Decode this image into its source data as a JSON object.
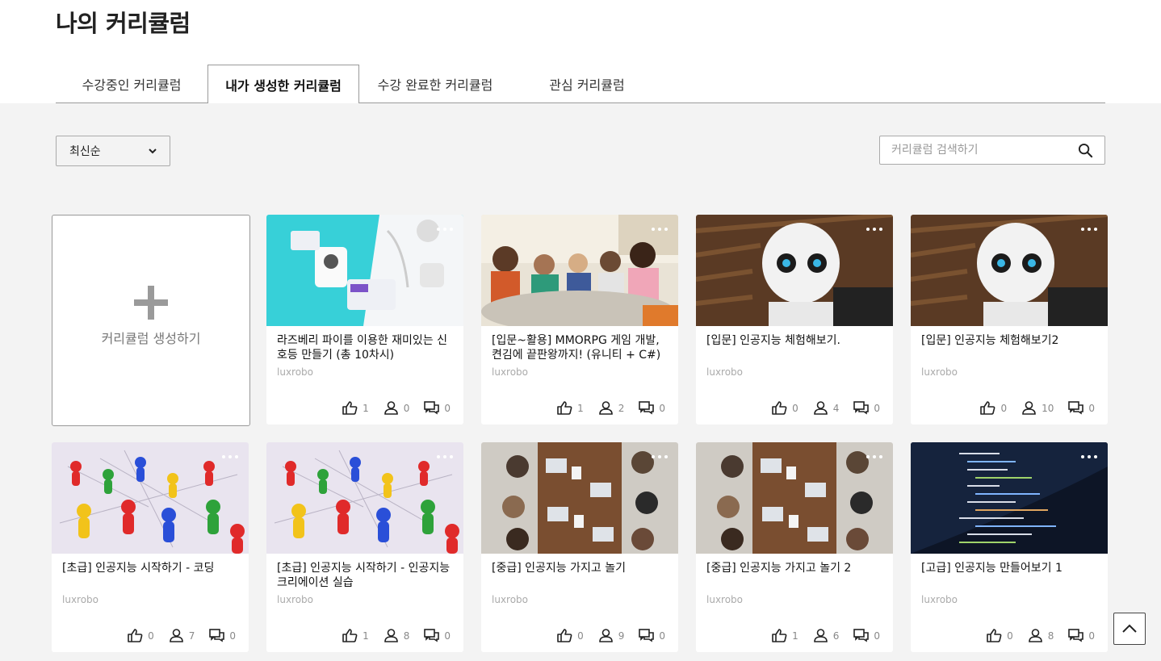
{
  "page": {
    "title": "나의 커리큘럼"
  },
  "tabs": [
    {
      "label": "수강중인 커리큘럼",
      "active": false
    },
    {
      "label": "내가 생성한 커리큘럼",
      "active": true
    },
    {
      "label": "수강 완료한 커리큘럼",
      "active": false
    },
    {
      "label": "관심 커리큘럼",
      "active": false
    }
  ],
  "sort": {
    "selected": "최신순",
    "icon": "chevron-down-icon"
  },
  "search": {
    "placeholder": "커리큘럼 검색하기",
    "value": "",
    "icon": "search-icon"
  },
  "create_card": {
    "label": "커리큘럼 생성하기",
    "icon": "plus-icon"
  },
  "cards": [
    {
      "title": "라즈베리 파이를 이용한 재미있는 신호등 만들기 (총 10차시)",
      "author": "luxrobo",
      "likes": "1",
      "students": "0",
      "comments": "0",
      "image": "robot-kit-modules"
    },
    {
      "title": "[입문~활용] MMORPG 게임 개발, 켠김에 끝판왕까지! (유니티 + C#)",
      "author": "luxrobo",
      "likes": "1",
      "students": "2",
      "comments": "0",
      "image": "students-at-table"
    },
    {
      "title": "[입문] 인공지능 체험해보기.",
      "author": "luxrobo",
      "likes": "0",
      "students": "4",
      "comments": "0",
      "image": "humanoid-robot"
    },
    {
      "title": "[입문] 인공지능 체험해보기2",
      "author": "luxrobo",
      "likes": "0",
      "students": "10",
      "comments": "0",
      "image": "humanoid-robot"
    },
    {
      "title": "[초급] 인공지능 시작하기 - 코딩",
      "author": "luxrobo",
      "likes": "0",
      "students": "7",
      "comments": "0",
      "image": "network-pawns"
    },
    {
      "title": "[초급] 인공지능 시작하기 - 인공지능 크리에이션 실습",
      "author": "luxrobo",
      "likes": "1",
      "students": "8",
      "comments": "0",
      "image": "network-pawns"
    },
    {
      "title": "[중급] 인공지능 가지고 놀기",
      "author": "luxrobo",
      "likes": "0",
      "students": "9",
      "comments": "0",
      "image": "meeting-table-top-view"
    },
    {
      "title": "[중급] 인공지능 가지고 놀기 2",
      "author": "luxrobo",
      "likes": "1",
      "students": "6",
      "comments": "0",
      "image": "meeting-table-top-view"
    },
    {
      "title": "[고급] 인공지능 만들어보기 1",
      "author": "luxrobo",
      "likes": "0",
      "students": "8",
      "comments": "0",
      "image": "code-on-screen"
    }
  ],
  "icons": {
    "like": "thumbs-up-icon",
    "students": "person-icon",
    "comments": "chat-bubbles-icon",
    "more": "more-dots-icon",
    "scroll_top": "chevron-up-icon"
  },
  "colors": {
    "content_bg": "#f3f3f3",
    "card_bg": "#ffffff",
    "tab_border": "#9a9a9a"
  }
}
